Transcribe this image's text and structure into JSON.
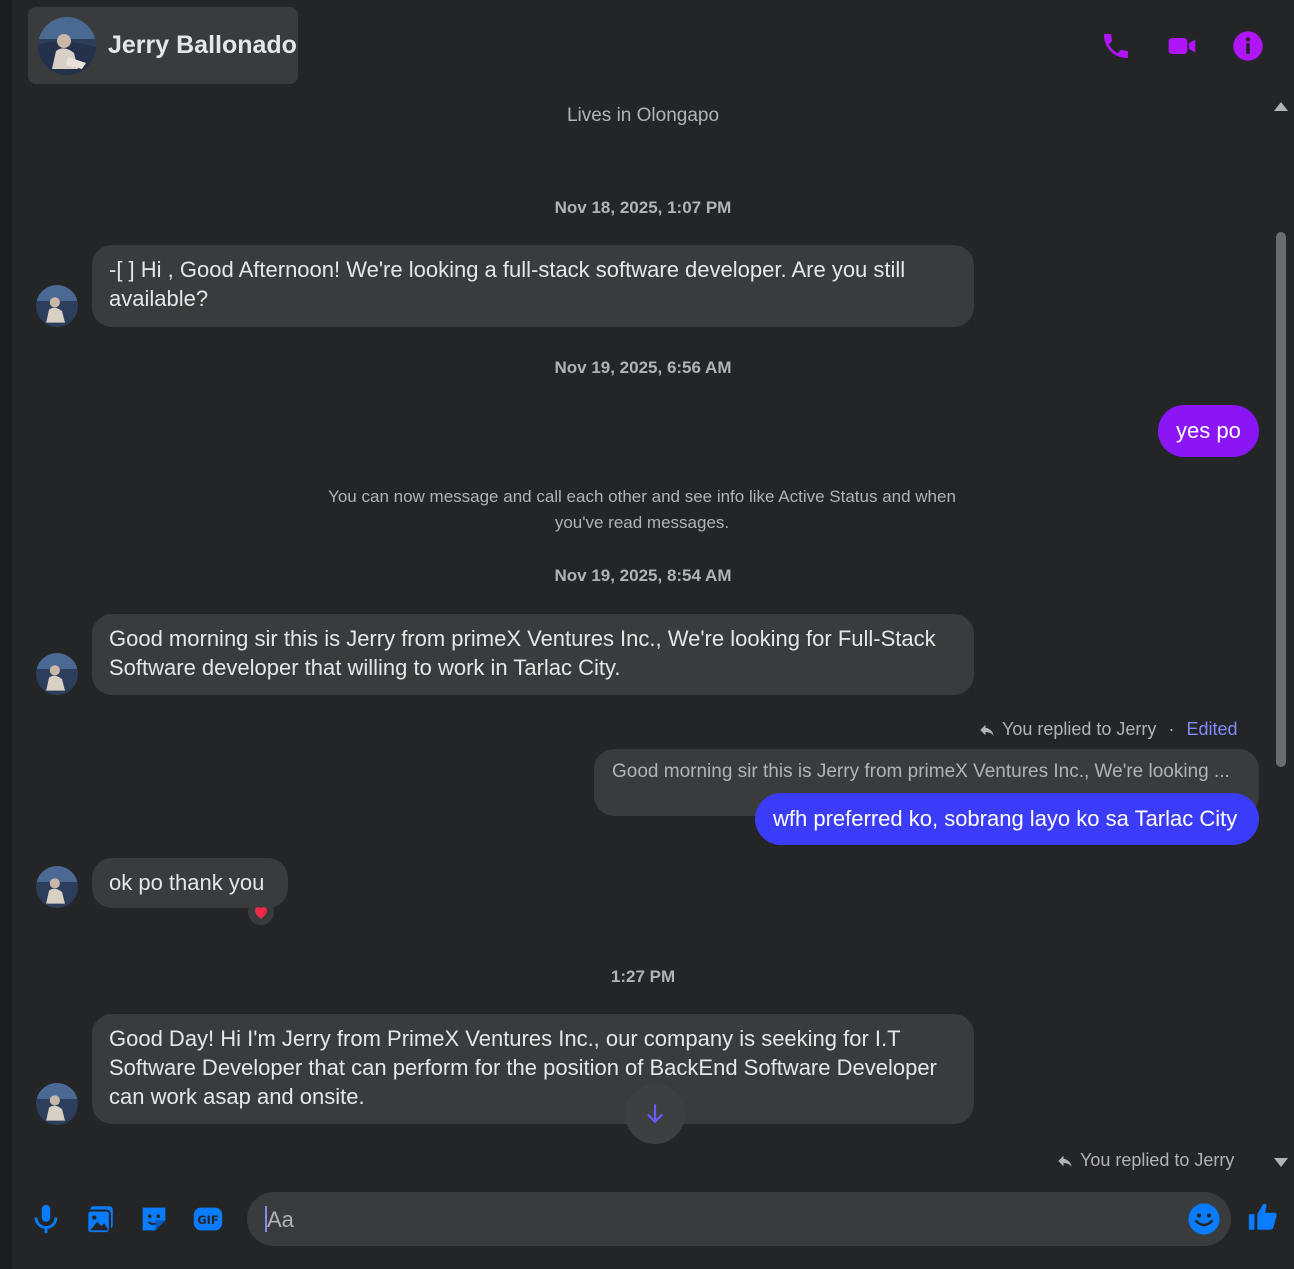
{
  "header": {
    "contact_name": "Jerry Ballonado",
    "icons": [
      "phone-icon",
      "video-camera-icon",
      "info-icon"
    ],
    "accent": "#b015f7"
  },
  "profile": {
    "location": "Lives in Olongapo"
  },
  "timestamps": {
    "t1": "Nov 18, 2025, 1:07 PM",
    "t2": "Nov 19, 2025, 6:56 AM",
    "t3": "Nov 19, 2025, 8:54 AM",
    "t4": "1:27 PM"
  },
  "messages": {
    "m1": "-[ ] Hi , Good Afternoon! We're looking a full-stack software developer. Are you still available?",
    "m2": "yes po",
    "system": "You can now message and call each other and see info like Active Status and when you've read messages.",
    "m3": "Good morning sir this is Jerry from primeX Ventures Inc., We're looking for Full-Stack Software developer that willing to work in Tarlac City.",
    "reply_label": "You replied to Jerry",
    "separator": "·",
    "edited": "Edited",
    "quoted": "Good morning sir this is Jerry from primeX Ventures Inc., We're looking ...",
    "m4": "wfh preferred ko, sobrang layo ko sa Tarlac City",
    "m5": "ok po thank you",
    "m5_reaction": "heart-reaction",
    "m6": "Good Day! Hi I'm Jerry from PrimeX Ventures Inc., our company is seeking for I.T Software Developer that can perform for the position of BackEnd Software Developer can work asap and onsite.",
    "reply_label_2": "You replied to Jerry"
  },
  "composer": {
    "placeholder": "Aa",
    "icons": [
      "microphone-icon",
      "image-icon",
      "sticker-icon",
      "gif-icon",
      "emoji-icon",
      "thumbs-up-icon"
    ],
    "icon_color": "#0a7cff"
  },
  "colors": {
    "bubble_incoming": "#3a3b3c",
    "bubble_outgoing_purple": "#8a16f5",
    "bubble_outgoing_blue": "#3b3cf8"
  }
}
